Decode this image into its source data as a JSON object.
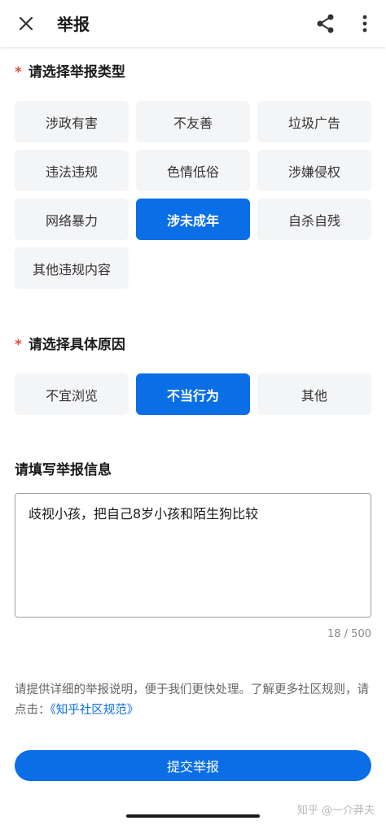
{
  "header": {
    "title": "举报",
    "close_icon": "close-icon",
    "share_icon": "share-icon",
    "more_icon": "more-vertical-icon"
  },
  "report_type": {
    "required_mark": "*",
    "title": "请选择举报类型",
    "options": [
      {
        "label": "涉政有害",
        "selected": false
      },
      {
        "label": "不友善",
        "selected": false
      },
      {
        "label": "垃圾广告",
        "selected": false
      },
      {
        "label": "违法违规",
        "selected": false
      },
      {
        "label": "色情低俗",
        "selected": false
      },
      {
        "label": "涉嫌侵权",
        "selected": false
      },
      {
        "label": "网络暴力",
        "selected": false
      },
      {
        "label": "涉未成年",
        "selected": true
      },
      {
        "label": "自杀自残",
        "selected": false
      },
      {
        "label": "其他违规内容",
        "selected": false
      }
    ]
  },
  "reason": {
    "required_mark": "*",
    "title": "请选择具体原因",
    "options": [
      {
        "label": "不宜浏览",
        "selected": false
      },
      {
        "label": "不当行为",
        "selected": true
      },
      {
        "label": "其他",
        "selected": false
      }
    ]
  },
  "info": {
    "title": "请填写举报信息",
    "value": "歧视小孩，把自己8岁小孩和陌生狗比较",
    "counter": "18 / 500"
  },
  "hint": {
    "text": "请提供详细的举报说明，便于我们更快处理。了解更多社区规则，请点击：",
    "link": "《知乎社区规范》"
  },
  "submit_label": "提交举报",
  "watermark": "知乎 @一介莽夫",
  "colors": {
    "accent": "#0a6ee6",
    "required": "#e54d42",
    "chip_bg": "#f4f5f7"
  }
}
